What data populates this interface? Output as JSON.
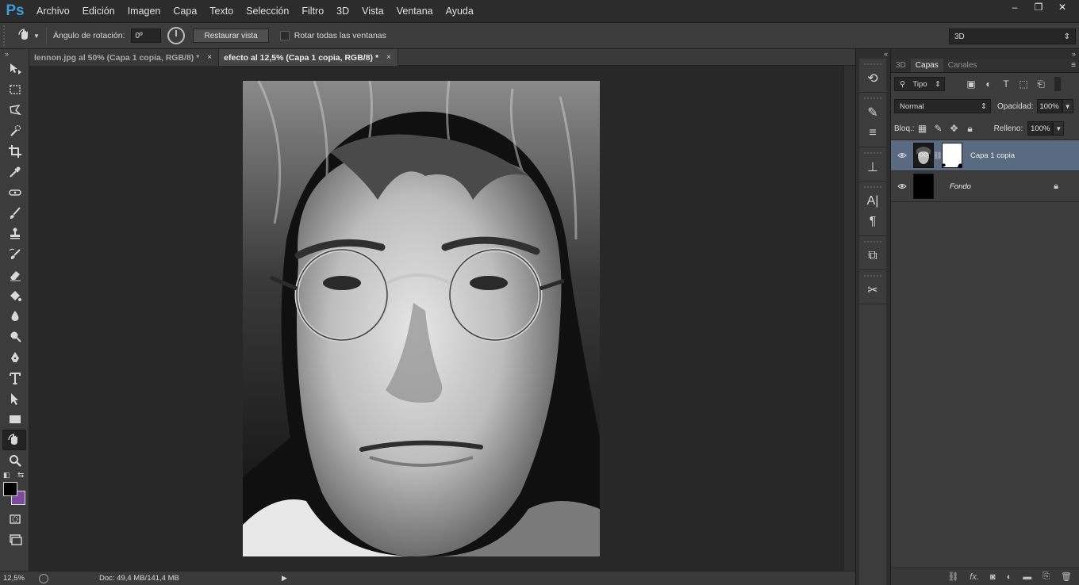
{
  "app": {
    "logo": "Ps"
  },
  "menu": [
    "Archivo",
    "Edición",
    "Imagen",
    "Capa",
    "Texto",
    "Selección",
    "Filtro",
    "3D",
    "Vista",
    "Ventana",
    "Ayuda"
  ],
  "window_controls": {
    "minimize": "–",
    "restore": "❐",
    "close": "✕"
  },
  "options": {
    "rotation_label": "Ángulo de rotación:",
    "rotation_value": "0º",
    "restore_button": "Restaurar vista",
    "rotate_all_label": "Rotar todas las ventanas",
    "workspace": "3D"
  },
  "tabs": [
    {
      "label": "lennon.jpg al 50% (Capa 1 copia, RGB/8) *",
      "close": "×"
    },
    {
      "label": "efecto al 12,5% (Capa 1 copia, RGB/8) *",
      "close": "×"
    }
  ],
  "status": {
    "zoom": "12,5%",
    "doc": "Doc: 49,4 MB/141,4 MB"
  },
  "colors": {
    "foreground": "#000000",
    "background": "#7a4c9b",
    "selected_layer": "#5a6a80"
  },
  "panel": {
    "tabs": [
      "3D",
      "Capas",
      "Canales"
    ],
    "filter": "Tipo",
    "blend_mode": "Normal",
    "opacity_label": "Opacidad:",
    "opacity_value": "100%",
    "lock_label": "Bloq.:",
    "fill_label": "Relleno:",
    "fill_value": "100%",
    "layers": [
      {
        "name": "Capa 1 copia",
        "selected": true
      },
      {
        "name": "Fondo",
        "locked": true
      }
    ]
  }
}
